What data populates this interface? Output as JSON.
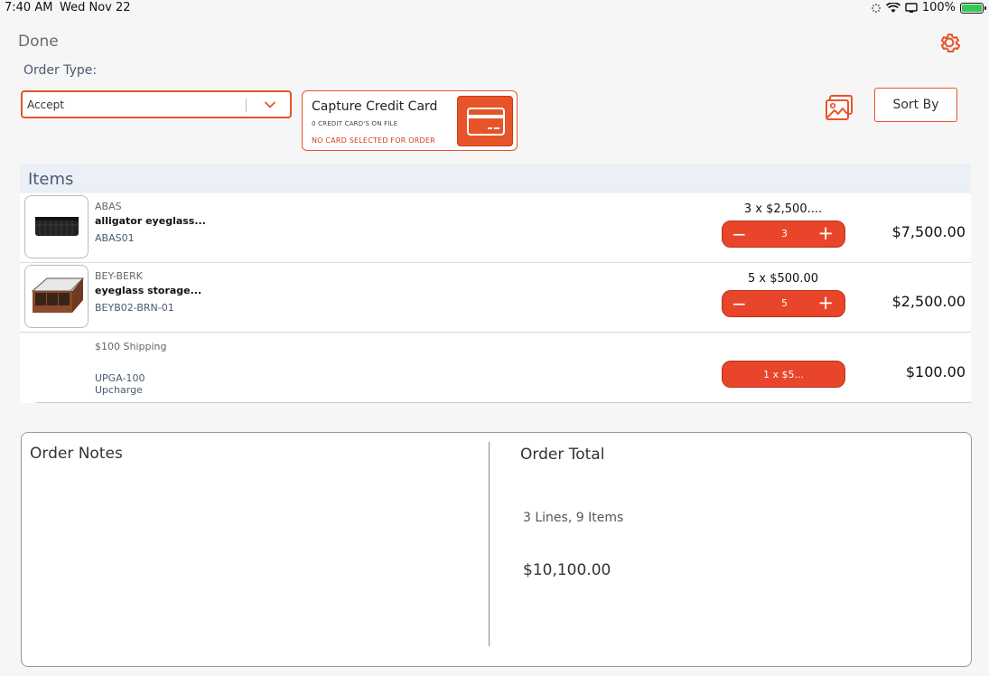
{
  "status_bar": {
    "time": "7:40 AM",
    "date": "Wed Nov 22",
    "battery": "100%"
  },
  "header": {
    "done_label": "Done",
    "order_type_label": "Order Type:",
    "order_type_value": "Accept"
  },
  "credit_card": {
    "title": "Capture Credit Card",
    "cards_on_file": "0 CREDIT CARD'S ON FILE",
    "warning": "NO CARD SELECTED FOR ORDER"
  },
  "toolbar": {
    "sort_label": "Sort By"
  },
  "items_section": {
    "title": "Items",
    "rows": [
      {
        "brand": "ABAS",
        "name": "alligator eyeglass...",
        "sku": "ABAS01",
        "qty_text": "3 x $2,500....",
        "qty": "3",
        "total": "$7,500.00"
      },
      {
        "brand": "BEY-BERK",
        "name": "eyeglass storage...",
        "sku": "BEYB02-BRN-01",
        "qty_text": "5 x $500.00",
        "qty": "5",
        "total": "$2,500.00"
      }
    ],
    "shipping": {
      "name": "$100 Shipping",
      "sku": "UPGA-100",
      "type": "Upcharge",
      "qty_label": "1 x $5...",
      "total": "$100.00"
    }
  },
  "summary": {
    "notes_title": "Order Notes",
    "total_title": "Order Total",
    "lines_items": "3 Lines, 9 Items",
    "total_amount": "$10,100.00"
  },
  "colors": {
    "accent": "#e8542a",
    "label": "#4a5a70",
    "items_header_bg": "#eaf0f5"
  }
}
